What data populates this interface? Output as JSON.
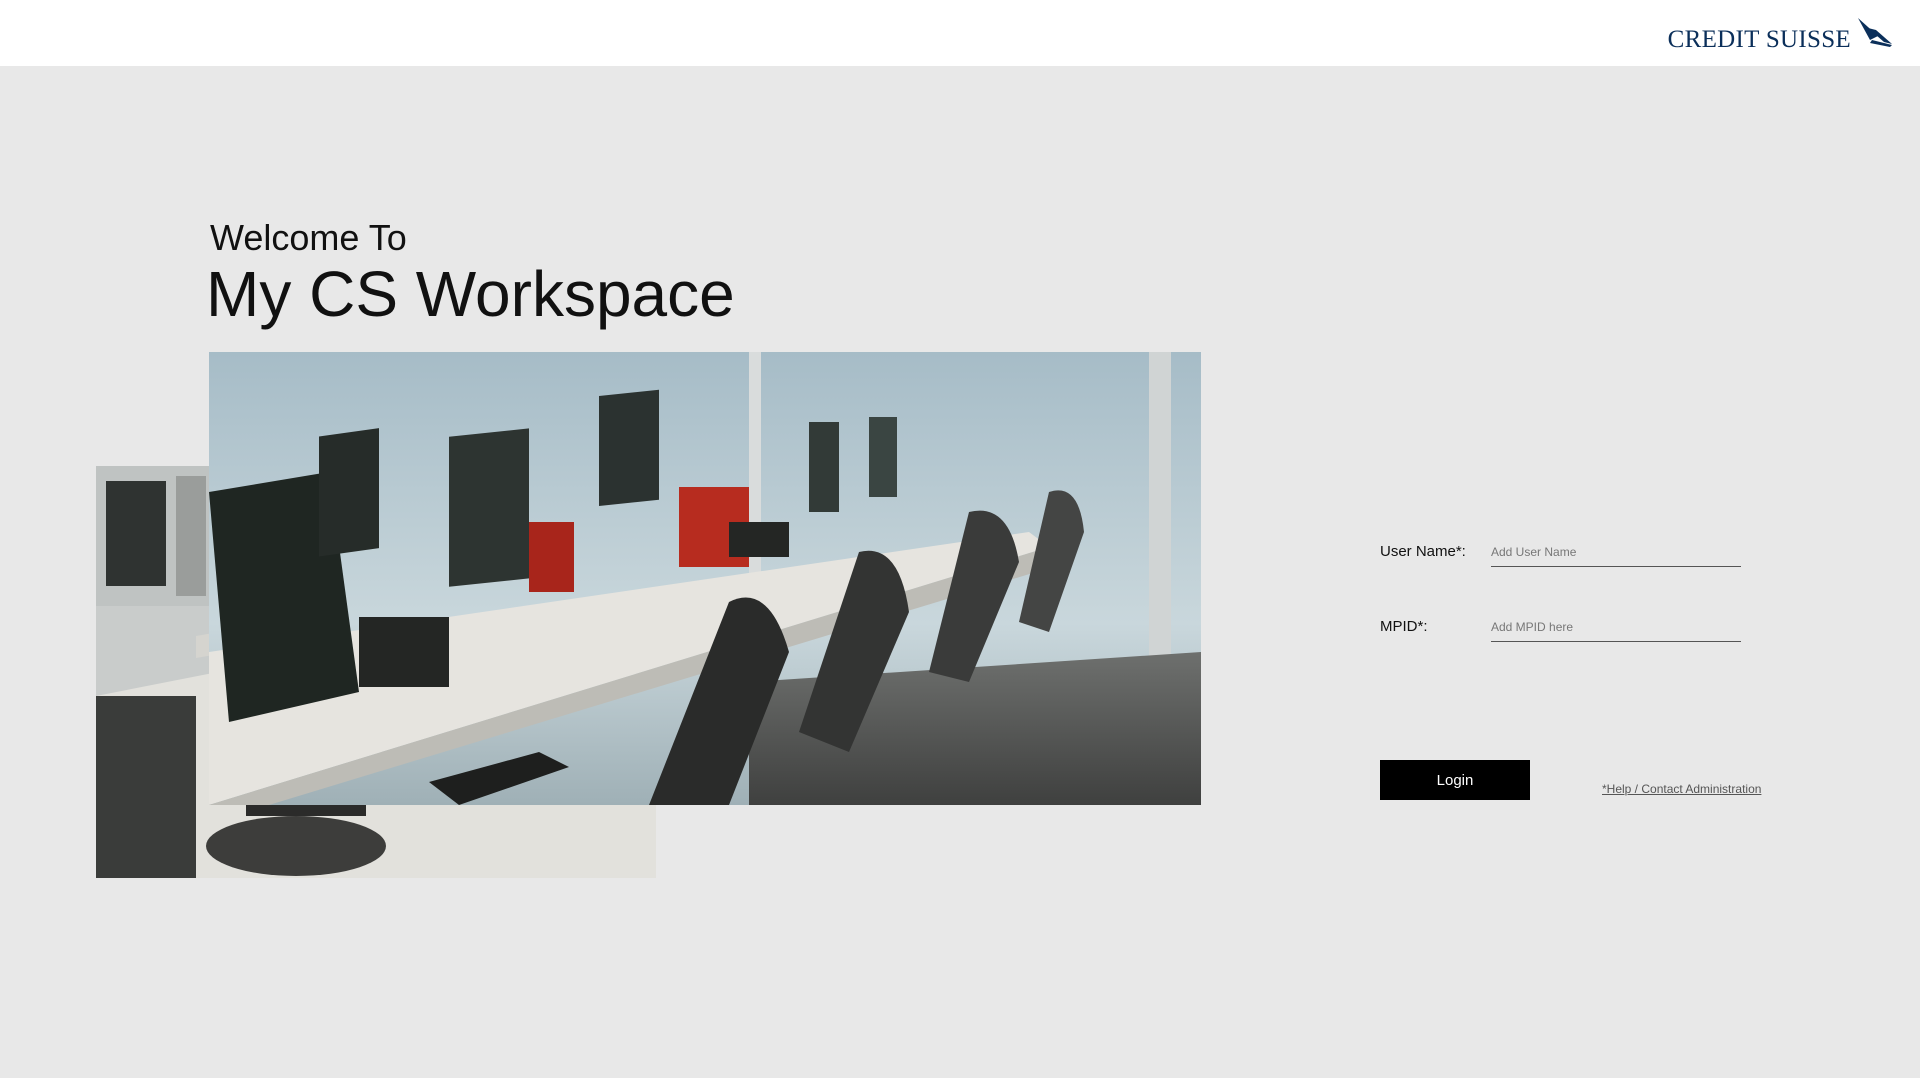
{
  "header": {
    "logo_text": "CREDIT SUISSE",
    "logo_icon": "sail-icon",
    "brand_color": "#0b2f5a"
  },
  "hero": {
    "welcome": "Welcome To",
    "title": "My CS Workspace"
  },
  "form": {
    "username_label": "User Name*:",
    "username_placeholder": "Add User Name",
    "username_value": "",
    "mpid_label": "MPID*:",
    "mpid_placeholder": "Add MPID here",
    "mpid_value": "",
    "login_label": "Login",
    "help_link": "*Help / Contact Administration"
  },
  "colors": {
    "background": "#e8e8e8",
    "topbar": "#ffffff",
    "button": "#000000",
    "button_text": "#ffffff"
  }
}
